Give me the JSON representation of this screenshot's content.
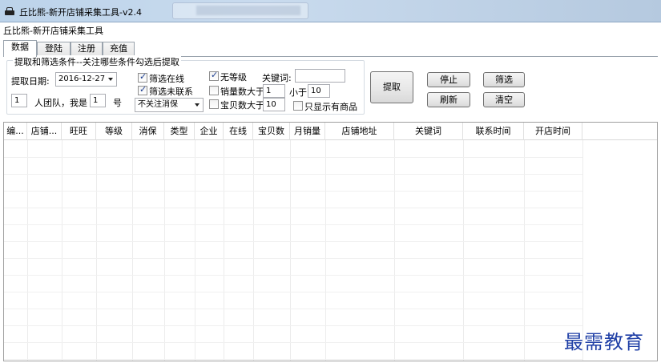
{
  "window": {
    "title": "丘比熊-新开店铺采集工具-v2.4",
    "subtitle": "丘比熊-新开店铺采集工具"
  },
  "tabs": [
    {
      "label": "数据",
      "active": true
    },
    {
      "label": "登陆",
      "active": false
    },
    {
      "label": "注册",
      "active": false
    },
    {
      "label": "充值",
      "active": false
    }
  ],
  "filter": {
    "group_title": "提取和筛选条件--关注哪些条件勾选后提取",
    "date_label": "提取日期:",
    "date_value": "2016-12-27",
    "team_count": "1",
    "team_label": "人团队，我是",
    "member_no": "1",
    "member_suffix": "号",
    "check_online": {
      "label": "筛选在线",
      "checked": true
    },
    "check_uncontacted": {
      "label": "筛选未联系",
      "checked": true
    },
    "deposit_select": "不关注消保",
    "check_no_grade": {
      "label": "无等级",
      "checked": true
    },
    "keyword_label": "关键词:",
    "keyword_value": "",
    "check_sales_gt": {
      "label": "销量数大于",
      "checked": false
    },
    "sales_gt_value": "1",
    "less_than_label": "小于",
    "sales_lt_value": "10",
    "check_items_gt": {
      "label": "宝贝数大于",
      "checked": false
    },
    "items_gt_value": "10",
    "check_only_goods": {
      "label": "只显示有商品",
      "checked": false
    }
  },
  "buttons": {
    "extract": "提取",
    "stop": "停止",
    "filter": "筛选",
    "refresh": "刷新",
    "clear": "清空"
  },
  "grid": {
    "columns": [
      "编...",
      "店铺...",
      "旺旺",
      "等级",
      "消保",
      "类型",
      "企业",
      "在线",
      "宝贝数",
      "月销量",
      "店铺地址",
      "关键词",
      "联系时间",
      "开店时间"
    ]
  },
  "watermark": "最需教育"
}
